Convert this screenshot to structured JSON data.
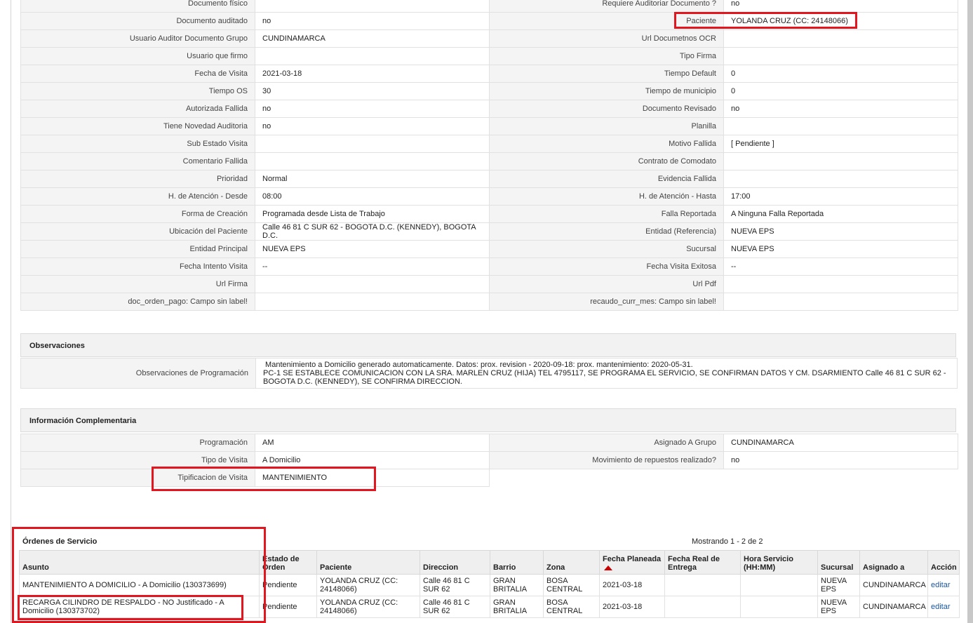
{
  "details": {
    "rows": [
      [
        "Documento físico",
        "",
        "Requiere Auditoriar Documento ?",
        "no"
      ],
      [
        "Documento auditado",
        "no",
        "Paciente",
        "YOLANDA CRUZ (CC: 24148066)"
      ],
      [
        "Usuario Auditor Documento Grupo",
        "CUNDINAMARCA",
        "Url Documetnos OCR",
        ""
      ],
      [
        "Usuario que firmo",
        "",
        "Tipo Firma",
        ""
      ],
      [
        "Fecha de Visita",
        "2021-03-18",
        "Tiempo Default",
        "0"
      ],
      [
        "Tiempo OS",
        "30",
        "Tiempo de municipio",
        "0"
      ],
      [
        "Autorizada Fallida",
        "no",
        "Documento Revisado",
        "no"
      ],
      [
        "Tiene Novedad Auditoria",
        "no",
        "Planilla",
        ""
      ],
      [
        "Sub Estado Visita",
        "",
        "Motivo Fallida",
        "[ Pendiente ]"
      ],
      [
        "Comentario Fallida",
        "",
        "Contrato de Comodato",
        ""
      ],
      [
        "Prioridad",
        "Normal",
        "Evidencia Fallida",
        ""
      ],
      [
        "H. de Atención - Desde",
        "08:00",
        "H. de Atención - Hasta",
        "17:00"
      ],
      [
        "Forma de Creación",
        "Programada desde Lista de Trabajo",
        "Falla Reportada",
        "A Ninguna Falla Reportada"
      ],
      [
        "Ubicación del Paciente",
        "Calle 46 81 C SUR 62 - BOGOTA D.C. (KENNEDY), BOGOTA D.C.",
        "Entidad (Referencia)",
        "NUEVA EPS"
      ],
      [
        "Entidad Principal",
        "NUEVA EPS",
        "Sucursal",
        "NUEVA EPS"
      ],
      [
        "Fecha Intento Visita",
        "--",
        "Fecha Visita Exitosa",
        "--"
      ],
      [
        "Url Firma",
        "",
        "Url Pdf",
        ""
      ],
      [
        "doc_orden_pago: Campo sin label!",
        "",
        "recaudo_curr_mes: Campo sin label!",
        ""
      ]
    ]
  },
  "observaciones": {
    "title": "Observaciones",
    "label": "Observaciones de Programación",
    "line1": " Mantenimiento a Domicilio generado automaticamente. Datos: prox. revision - 2020-09-18: prox. mantenimiento: 2020-05-31.",
    "line2": " PC-1 SE ESTABLECE COMUNICACION CON LA SRA. MARLEN CRUZ (HIJA) TEL 4795117, SE PROGRAMA EL SERVICIO, SE CONFIRMAN DATOS Y CM. DSARMIENTO Calle 46 81 C SUR 62 - BOGOTA D.C. (KENNEDY), SE CONFIRMA DIRECCION."
  },
  "complementaria": {
    "title": "Información Complementaria",
    "rows": [
      [
        "Programación",
        "AM",
        "Asignado A Grupo",
        "CUNDINAMARCA"
      ],
      [
        "Tipo de Visita",
        "A Domicilio",
        "Movimiento de repuestos realizado?",
        "no"
      ],
      [
        "Tipificacion de Visita",
        "MANTENIMIENTO",
        "",
        ""
      ]
    ]
  },
  "ordenes": {
    "title": "Órdenes de Servicio",
    "showing": "Mostrando 1 - 2 de 2",
    "columns": [
      "Asunto",
      "Estado de Orden",
      "Paciente",
      "Direccion",
      "Barrio",
      "Zona",
      "Fecha Planeada",
      "Fecha Real de Entrega",
      "Hora Servicio (HH:MM)",
      "Sucursal",
      "Asignado a",
      "Acción"
    ],
    "rows": [
      [
        "MANTENIMIENTO A DOMICILIO - A Domicilio (130373699)",
        "Pendiente",
        "YOLANDA CRUZ (CC: 24148066)",
        "Calle 46 81 C SUR 62",
        "GRAN BRITALIA",
        "BOSA CENTRAL",
        "2021-03-18",
        "",
        "",
        "NUEVA EPS",
        "CUNDINAMARCA",
        "editar"
      ],
      [
        "RECARGA CILINDRO DE RESPALDO - NO Justificado - A Domicilio (130373702)",
        "Pendiente",
        "YOLANDA CRUZ (CC: 24148066)",
        "Calle 46 81 C SUR 62",
        "GRAN BRITALIA",
        "BOSA CENTRAL",
        "2021-03-18",
        "",
        "",
        "NUEVA EPS",
        "CUNDINAMARCA",
        "editar"
      ]
    ]
  },
  "colors": {
    "highlight": "#e3151f",
    "link": "#1a56a3",
    "label_bg": "#f4f4f4"
  }
}
